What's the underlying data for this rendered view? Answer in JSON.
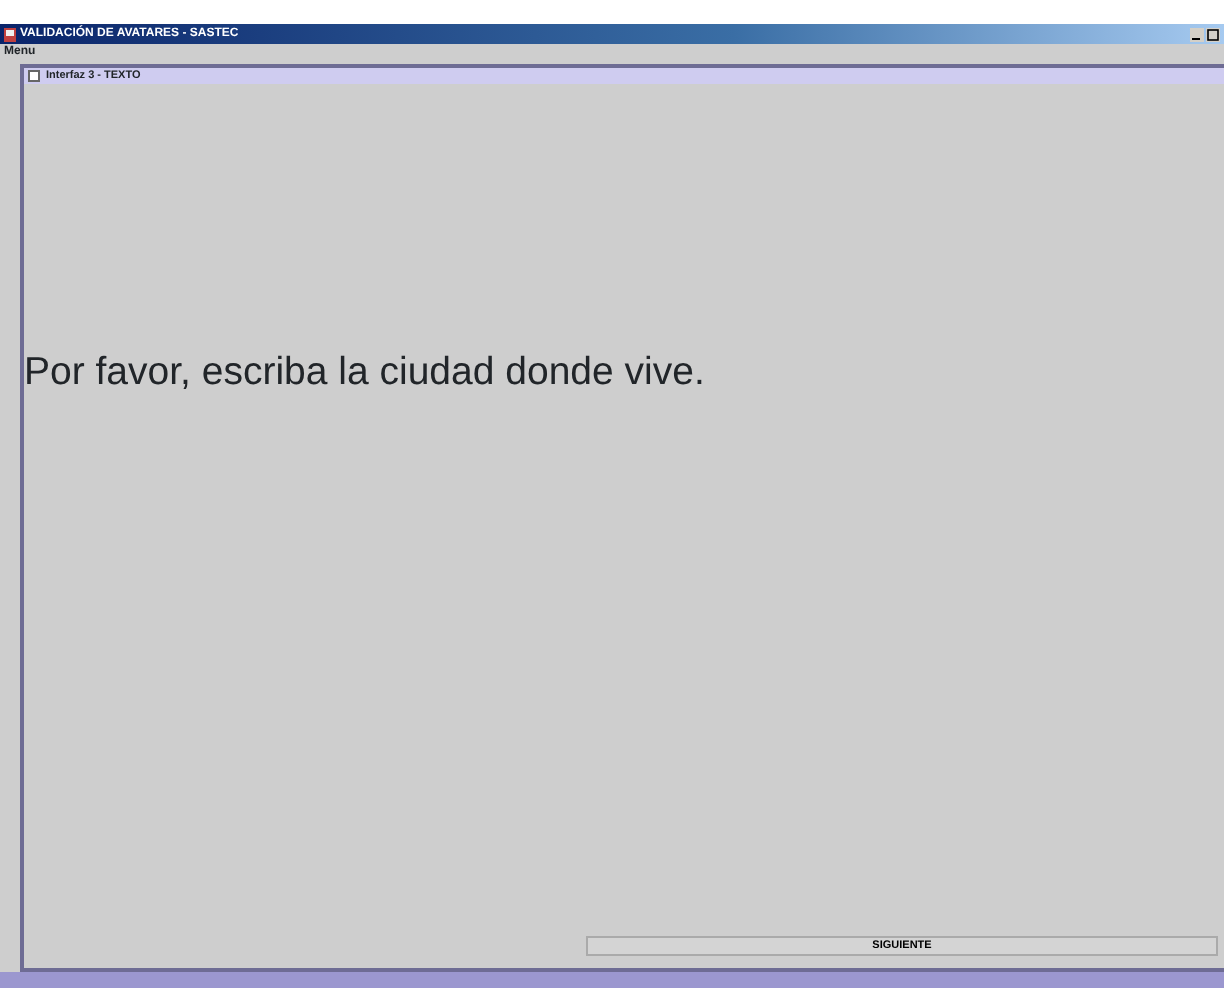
{
  "window": {
    "title": "VALIDACIÓN DE AVATARES - SASTEC"
  },
  "menu": [
    "Menu"
  ],
  "frame": {
    "title": "Interfaz 3 - TEXTO"
  },
  "prompt": "Por favor, escriba la ciudad donde vive.",
  "buttons": [
    "SIGUIENTE"
  ]
}
